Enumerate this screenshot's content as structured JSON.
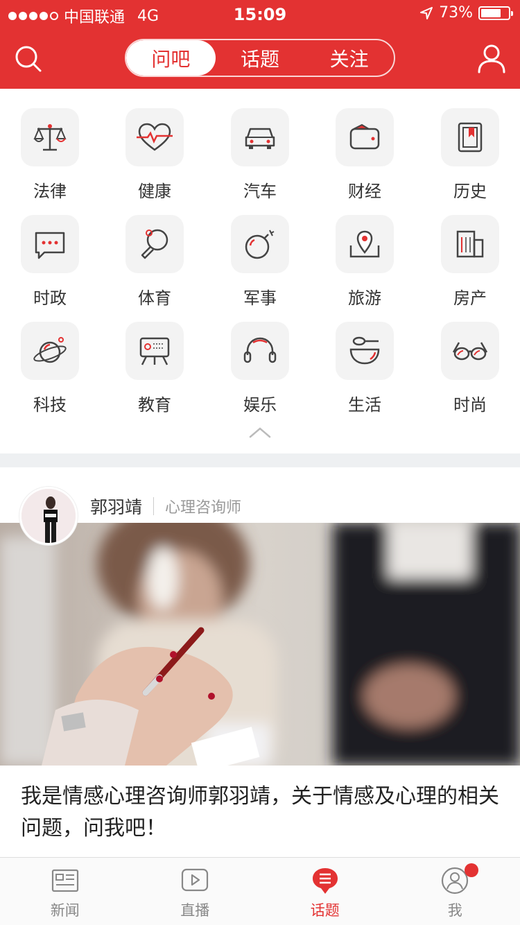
{
  "status_bar": {
    "carrier": "中国联通",
    "network": "4G",
    "time": "15:09",
    "battery": "73%",
    "battery_level": 0.73
  },
  "header": {
    "tabs": [
      {
        "label": "问吧",
        "active": true
      },
      {
        "label": "话题",
        "active": false
      },
      {
        "label": "关注",
        "active": false
      }
    ]
  },
  "categories": [
    {
      "label": "法律",
      "icon": "scales-icon"
    },
    {
      "label": "健康",
      "icon": "heart-pulse-icon"
    },
    {
      "label": "汽车",
      "icon": "car-icon"
    },
    {
      "label": "财经",
      "icon": "wallet-icon"
    },
    {
      "label": "历史",
      "icon": "book-icon"
    },
    {
      "label": "时政",
      "icon": "chat-bubble-icon"
    },
    {
      "label": "体育",
      "icon": "ping-pong-icon"
    },
    {
      "label": "军事",
      "icon": "bomb-icon"
    },
    {
      "label": "旅游",
      "icon": "map-pin-icon"
    },
    {
      "label": "房产",
      "icon": "building-icon"
    },
    {
      "label": "科技",
      "icon": "planet-icon"
    },
    {
      "label": "教育",
      "icon": "blackboard-icon"
    },
    {
      "label": "娱乐",
      "icon": "headphones-icon"
    },
    {
      "label": "生活",
      "icon": "bowl-icon"
    },
    {
      "label": "时尚",
      "icon": "sunglasses-icon"
    }
  ],
  "feed": {
    "author_name": "郭羽靖",
    "author_title": "心理咨询师",
    "caption": "我是情感心理咨询师郭羽靖，关于情感及心理的相关问题，问我吧！"
  },
  "tabbar": [
    {
      "label": "新闻",
      "icon": "newspaper-icon",
      "active": false
    },
    {
      "label": "直播",
      "icon": "play-icon",
      "active": false
    },
    {
      "label": "话题",
      "icon": "topic-bubble-icon",
      "active": true
    },
    {
      "label": "我",
      "icon": "user-circle-icon",
      "active": false,
      "badge": true
    }
  ],
  "colors": {
    "brand_red": "#e33232",
    "icon_bg": "#f3f3f3",
    "icon_stroke": "#444444"
  }
}
